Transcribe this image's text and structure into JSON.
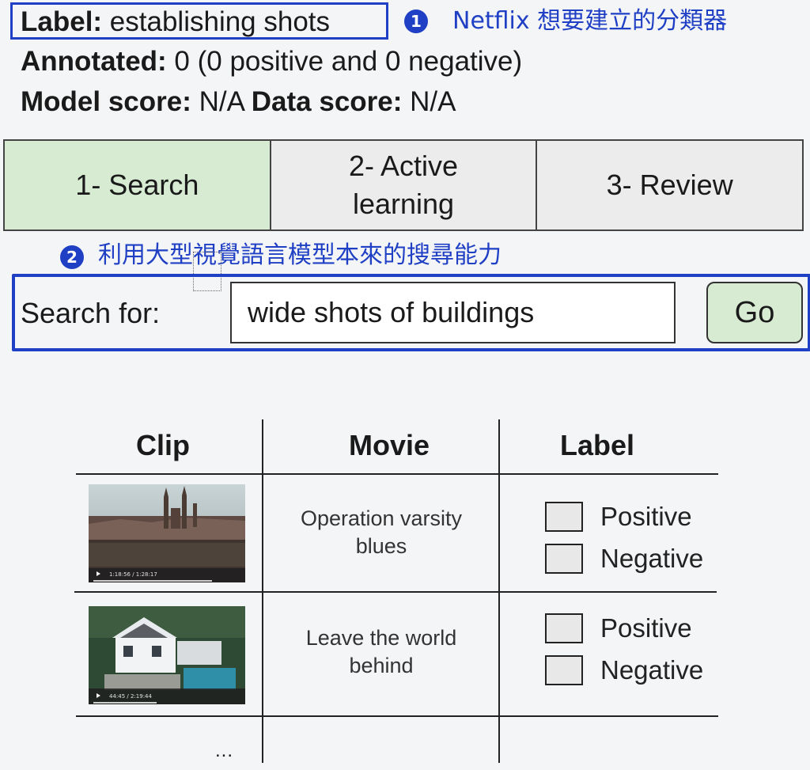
{
  "info": {
    "label_key": "Label:",
    "label_value": " establishing shots",
    "annotated_key": "Annotated:",
    "annotated_value": " 0 (0 positive and 0 negative)",
    "model_score_key": "Model score:",
    "model_score_value": " N/A ",
    "data_score_key": "Data score:",
    "data_score_value": " N/A"
  },
  "annotations": {
    "note1_badge": "1",
    "note1_text": "Netflix 想要建立的分類器",
    "note2_badge": "2",
    "note2_text": "利用大型視覺語言模型本來的搜尋能力"
  },
  "tabs": [
    {
      "label": "1- Search",
      "active": true
    },
    {
      "label": "2- Active learning",
      "active": false
    },
    {
      "label": "3- Review",
      "active": false
    }
  ],
  "search": {
    "label": "Search for:",
    "value": "wide shots of buildings",
    "go_label": "Go"
  },
  "table": {
    "headers": {
      "clip": "Clip",
      "movie": "Movie",
      "label": "Label"
    },
    "rows": [
      {
        "movie": "Operation varsity blues",
        "positive": "Positive",
        "negative": "Negative",
        "time": "1:18:56 / 1:28:17"
      },
      {
        "movie": "Leave the world behind",
        "positive": "Positive",
        "negative": "Negative",
        "time": "44:45 / 2:19:44"
      }
    ],
    "more": "..."
  },
  "colors": {
    "accent": "#1f3fc4",
    "active_tab": "#d6ebd2",
    "inactive_tab": "#ececec",
    "go_button": "#d6ebd2"
  }
}
